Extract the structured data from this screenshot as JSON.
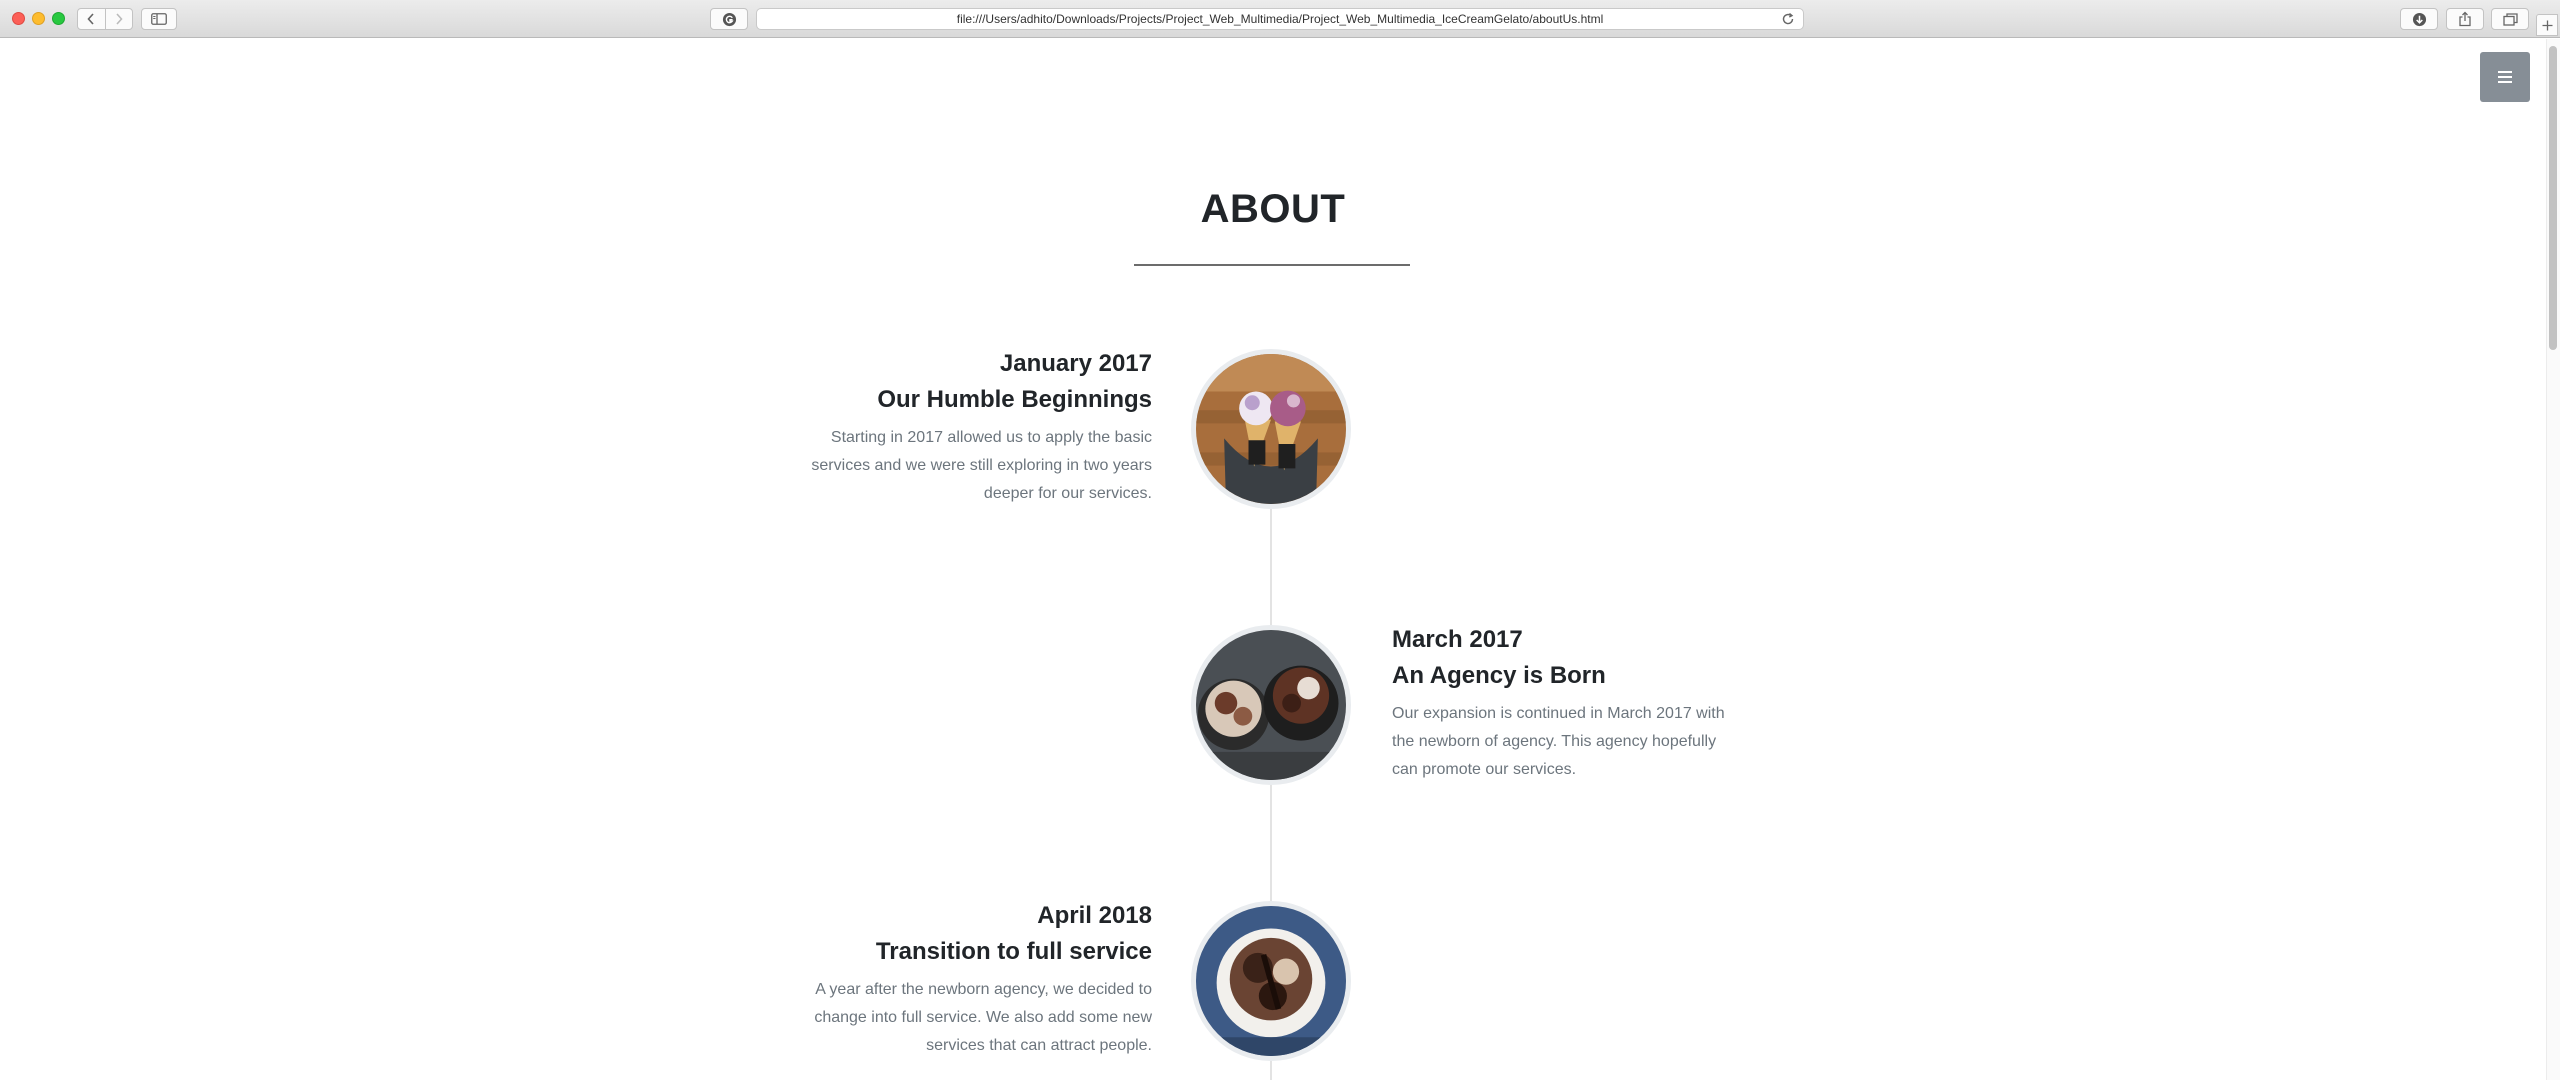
{
  "browser": {
    "url": "file:///Users/adhito/Downloads/Projects/Project_Web_Multimedia/Project_Web_Multimedia_IceCreamGelato/aboutUs.html"
  },
  "page": {
    "title": "ABOUT",
    "menu_icon": "hamburger-icon"
  },
  "timeline": [
    {
      "date": "January 2017",
      "heading": "Our Humble Beginnings",
      "body": "Starting in 2017 allowed us to apply the basic services and we were still exploring in two years deeper for our services.",
      "side": "left",
      "image": "ice-cream-cones-photo"
    },
    {
      "date": "March 2017",
      "heading": "An Agency is Born",
      "body": "Our expansion is continued in March 2017 with the newborn of agency. This agency hopefully can promote our services.",
      "side": "right",
      "image": "gelato-cups-photo"
    },
    {
      "date": "April 2018",
      "heading": "Transition to full service",
      "body": "A year after the newborn agency, we decided to change into full service. We also add some new services that can attract people.",
      "side": "left",
      "image": "chocolate-gelato-bowl-photo"
    }
  ]
}
